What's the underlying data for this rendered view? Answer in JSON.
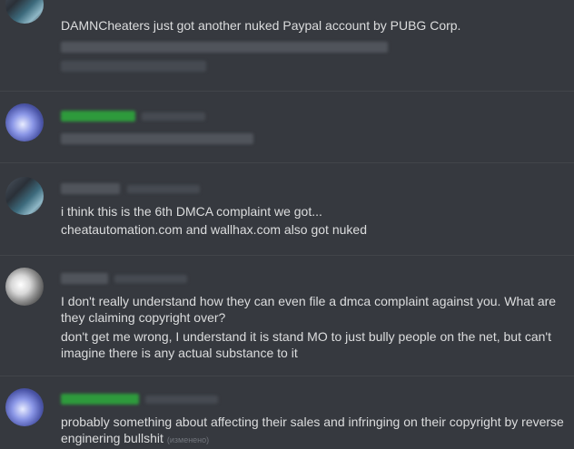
{
  "messages": [
    {
      "text": "DAMNCheaters just got another nuked Paypal account by PUBG Corp."
    },
    {
      "text": "i think this is the 6th DMCA complaint we got..."
    },
    {
      "text": "cheatautomation.com and wallhax.com also got nuked"
    },
    {
      "text": "I don't really understand how they can even file a dmca complaint against you. What are they claiming copyright over?"
    },
    {
      "text": "don't get me wrong, I understand it is stand MO to just bully people on the net, but can't imagine there is any actual substance to it"
    },
    {
      "text": "probably something about affecting their sales and infringing on their copyright by reverse enginering bullshit",
      "edited": "(изменено)"
    }
  ],
  "colors": {
    "background": "#36393f",
    "message_text": "#dcddde",
    "username_green": "#2e9a3c",
    "edited_label": "#72767d"
  }
}
